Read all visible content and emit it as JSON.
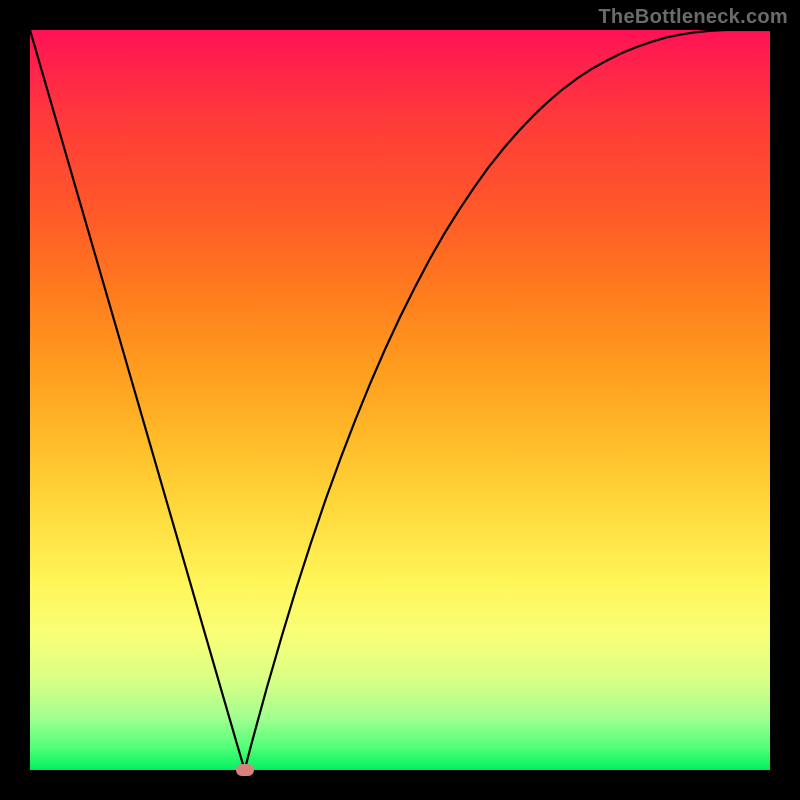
{
  "watermark": "TheBottleneck.com",
  "chart_data": {
    "type": "line",
    "title": "",
    "xlabel": "",
    "ylabel": "",
    "xlim": [
      0,
      100
    ],
    "ylim": [
      0,
      100
    ],
    "grid": false,
    "x": [
      0,
      2,
      4,
      6,
      8,
      10,
      12,
      14,
      16,
      18,
      20,
      22,
      24,
      26,
      28,
      29,
      30,
      32,
      34,
      36,
      38,
      40,
      42,
      44,
      46,
      48,
      50,
      52,
      54,
      56,
      58,
      60,
      62,
      64,
      66,
      68,
      70,
      72,
      74,
      76,
      78,
      80,
      82,
      84,
      86,
      88,
      90,
      92,
      94,
      96,
      98,
      100
    ],
    "y": [
      100,
      93.1,
      86.2,
      79.3,
      72.4,
      65.5,
      58.6,
      51.7,
      44.8,
      37.9,
      31.0,
      24.1,
      17.2,
      10.3,
      3.4,
      0,
      3.8,
      11.1,
      18.0,
      24.6,
      30.8,
      36.7,
      42.2,
      47.4,
      52.3,
      56.9,
      61.2,
      65.2,
      69.0,
      72.5,
      75.7,
      78.7,
      81.5,
      84.0,
      86.3,
      88.4,
      90.3,
      92.0,
      93.5,
      94.8,
      95.9,
      96.9,
      97.7,
      98.4,
      99.0,
      99.4,
      99.7,
      99.9,
      100.0,
      100.0,
      100.0,
      100.0
    ],
    "marker": {
      "x": 29,
      "y": 0,
      "color": "#d9827d"
    }
  }
}
